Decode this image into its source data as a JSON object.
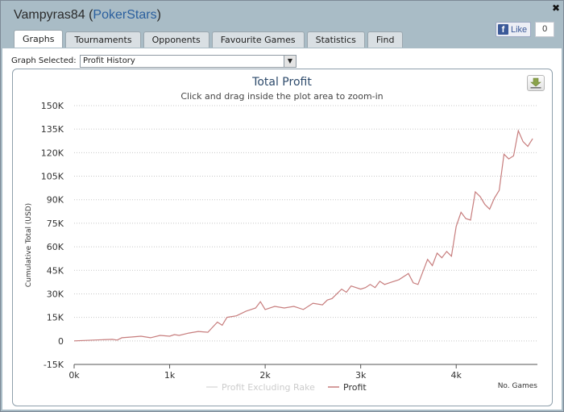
{
  "window": {
    "player": "Vampyras84",
    "network": "PokerStars",
    "network_open": "(",
    "network_close": ")",
    "close_glyph": "✖",
    "like_label": "Like",
    "like_count": "0"
  },
  "tabs": [
    {
      "label": "Graphs",
      "active": true
    },
    {
      "label": "Tournaments"
    },
    {
      "label": "Opponents"
    },
    {
      "label": "Favourite Games"
    },
    {
      "label": "Statistics"
    },
    {
      "label": "Find"
    }
  ],
  "graph_select": {
    "label": "Graph Selected:",
    "value": "Profit History"
  },
  "colors": {
    "profit": "#c77d7d",
    "profit_excluding_rake": "#dddddd",
    "title": "#2d4a6b",
    "grid": "#c8c8c8"
  },
  "chart_data": {
    "type": "line",
    "title": "Total Profit",
    "subtitle": "Click and drag inside the plot area to zoom-in",
    "ylabel": "Cumulative Total (USD)",
    "xlabel": "No. Games",
    "ylim": [
      -15000,
      150000
    ],
    "xlim": [
      0,
      4850
    ],
    "yticks": [
      -15000,
      0,
      15000,
      30000,
      45000,
      60000,
      75000,
      90000,
      105000,
      120000,
      135000,
      150000
    ],
    "ytick_labels": [
      "-15K",
      "0",
      "15K",
      "30K",
      "45K",
      "60K",
      "75K",
      "90K",
      "105K",
      "120K",
      "135K",
      "150K"
    ],
    "xticks": [
      0,
      1000,
      2000,
      3000,
      4000
    ],
    "xtick_labels": [
      "0k",
      "1k",
      "2k",
      "3k",
      "4k"
    ],
    "grid": true,
    "legend": [
      {
        "name": "Profit Excluding Rake",
        "color_key": "profit_excluding_rake"
      },
      {
        "name": "Profit",
        "color_key": "profit"
      }
    ],
    "legend_position": "bottom-center",
    "series": [
      {
        "name": "Profit",
        "x": [
          0,
          200,
          400,
          450,
          500,
          600,
          700,
          800,
          900,
          1000,
          1050,
          1100,
          1200,
          1300,
          1400,
          1500,
          1550,
          1600,
          1700,
          1800,
          1900,
          1950,
          2000,
          2100,
          2200,
          2300,
          2400,
          2500,
          2600,
          2650,
          2700,
          2800,
          2850,
          2900,
          3000,
          3050,
          3100,
          3150,
          3200,
          3250,
          3300,
          3400,
          3500,
          3550,
          3600,
          3700,
          3750,
          3800,
          3850,
          3900,
          3950,
          4000,
          4050,
          4100,
          4150,
          4200,
          4250,
          4300,
          4350,
          4400,
          4450,
          4500,
          4550,
          4600,
          4650,
          4700,
          4750,
          4800
        ],
        "y": [
          0,
          500,
          1000,
          500,
          2000,
          2500,
          3000,
          2000,
          3500,
          3000,
          4000,
          3500,
          5000,
          6000,
          5500,
          12000,
          10000,
          15000,
          16000,
          19000,
          21000,
          25000,
          20000,
          22000,
          21000,
          22000,
          20000,
          24000,
          23000,
          26000,
          27000,
          33000,
          31000,
          35000,
          33000,
          34000,
          36000,
          34000,
          38000,
          36000,
          37000,
          39000,
          43000,
          37000,
          36000,
          52000,
          48000,
          56000,
          53000,
          57000,
          54000,
          73000,
          82000,
          78000,
          77000,
          95000,
          92000,
          87000,
          84000,
          91000,
          96000,
          119000,
          116000,
          118000,
          134000,
          127000,
          124000,
          129000
        ]
      }
    ]
  }
}
